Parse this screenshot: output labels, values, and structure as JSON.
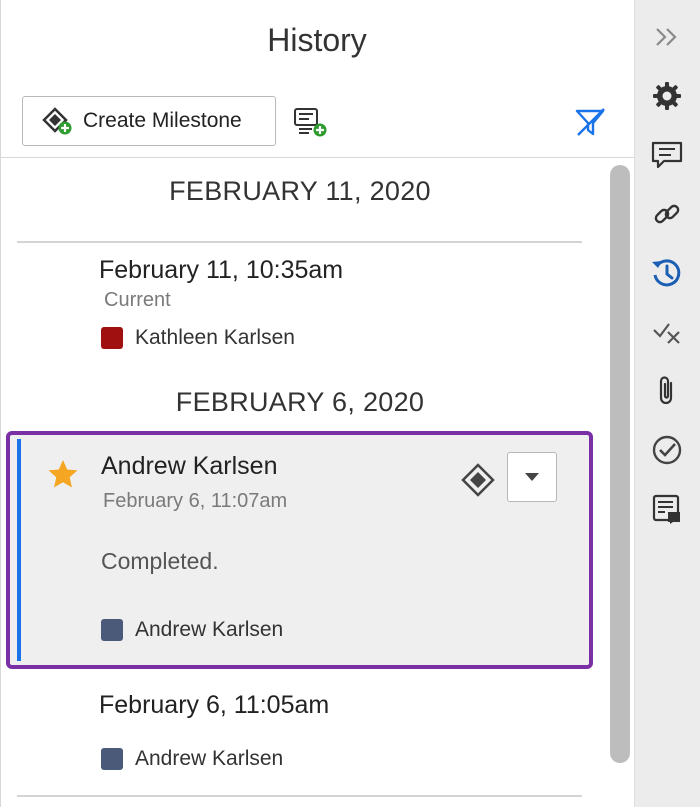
{
  "panel": {
    "title": "History",
    "create_milestone_label": "Create Milestone"
  },
  "groups": [
    {
      "date": "FEBRUARY 11, 2020",
      "entries": [
        {
          "time": "February 11, 10:35am",
          "status": "Current",
          "author": "Kathleen Karlsen",
          "author_color": "#a01010"
        }
      ]
    },
    {
      "date": "FEBRUARY 6, 2020",
      "entries": [
        {
          "title": "Andrew Karlsen",
          "time": "February 6, 11:07am",
          "comment": "Completed.",
          "author": "Andrew Karlsen",
          "author_color": "#4a5a78",
          "starred": true,
          "milestone": true,
          "selected": true
        },
        {
          "time": "February 6, 11:05am",
          "author": "Andrew Karlsen",
          "author_color": "#4a5a78"
        }
      ]
    }
  ],
  "colors": {
    "selection_border": "#7b2fa5",
    "selection_accent": "#1a73e8",
    "star": "#f5a623",
    "rail_icon_active": "#1a5fb4",
    "filter_icon": "#1a73e8"
  },
  "rail": {
    "icons": [
      "collapse-icon",
      "gear-icon",
      "comment-icon",
      "link-icon",
      "history-icon",
      "check-x-icon",
      "paperclip-icon",
      "checkmark-circle-icon",
      "form-icon"
    ],
    "active": "history-icon"
  }
}
